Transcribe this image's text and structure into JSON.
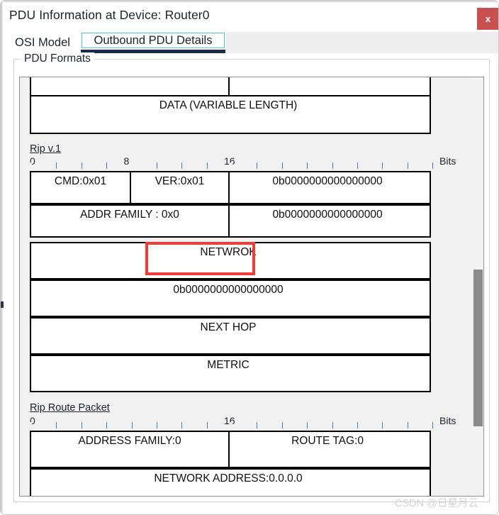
{
  "window": {
    "title": "PDU Information at Device: Router0",
    "close_label": "x",
    "close_color": "#c9504f"
  },
  "tabs": [
    {
      "label": "OSI Model",
      "active": false
    },
    {
      "label": "Outbound PDU Details",
      "active": true
    }
  ],
  "groupbox": {
    "legend": "PDU Formats"
  },
  "sections": [
    {
      "name": "data-section",
      "label": "",
      "rows": [
        {
          "cells": [
            {
              "text": "",
              "flex": 280
            },
            {
              "text": "",
              "flex": 280
            }
          ]
        },
        {
          "cells": [
            {
              "text": "DATA (VARIABLE LENGTH)",
              "flex": 560
            }
          ]
        }
      ]
    },
    {
      "name": "rip-v1",
      "label": "Rip v.1",
      "ruler": {
        "marks": [
          "0",
          "8",
          "16"
        ],
        "bits_label": "Bits"
      },
      "rows": [
        {
          "cells": [
            {
              "text": "CMD:0x01",
              "flex": 140
            },
            {
              "text": "VER:0x01",
              "flex": 140
            },
            {
              "text": "0b0000000000000000",
              "flex": 280
            }
          ]
        },
        {
          "cells": [
            {
              "text": "ADDR FAMILY : 0x0",
              "flex": 280
            },
            {
              "text": "0b0000000000000000",
              "flex": 280
            }
          ]
        },
        {
          "cells": [
            {
              "text": "NETWROK",
              "flex": 560
            }
          ]
        },
        {
          "cells": [
            {
              "text": "0b0000000000000000",
              "flex": 560
            }
          ]
        },
        {
          "cells": [
            {
              "text": "NEXT HOP",
              "flex": 560
            }
          ]
        },
        {
          "cells": [
            {
              "text": "METRIC",
              "flex": 560
            }
          ]
        }
      ]
    },
    {
      "name": "rip-route-packet",
      "label": "Rip Route Packet",
      "ruler": {
        "marks": [
          "0",
          "16"
        ],
        "bits_label": "Bits"
      },
      "rows": [
        {
          "cells": [
            {
              "text": "ADDRESS FAMILY:0",
              "flex": 280
            },
            {
              "text": "ROUTE TAG:0",
              "flex": 280
            }
          ]
        },
        {
          "cells": [
            {
              "text": "NETWORK ADDRESS:0.0.0.0",
              "flex": 560
            }
          ]
        }
      ]
    }
  ],
  "highlight": {
    "field": "VER:0x01",
    "color": "#f23b32"
  },
  "scrollbar": {
    "orientation": "vertical",
    "thumb_color": "#8a8a8a",
    "track_color": "#f2f2f2"
  },
  "watermark": {
    "text": "CSDN @日星月云"
  }
}
